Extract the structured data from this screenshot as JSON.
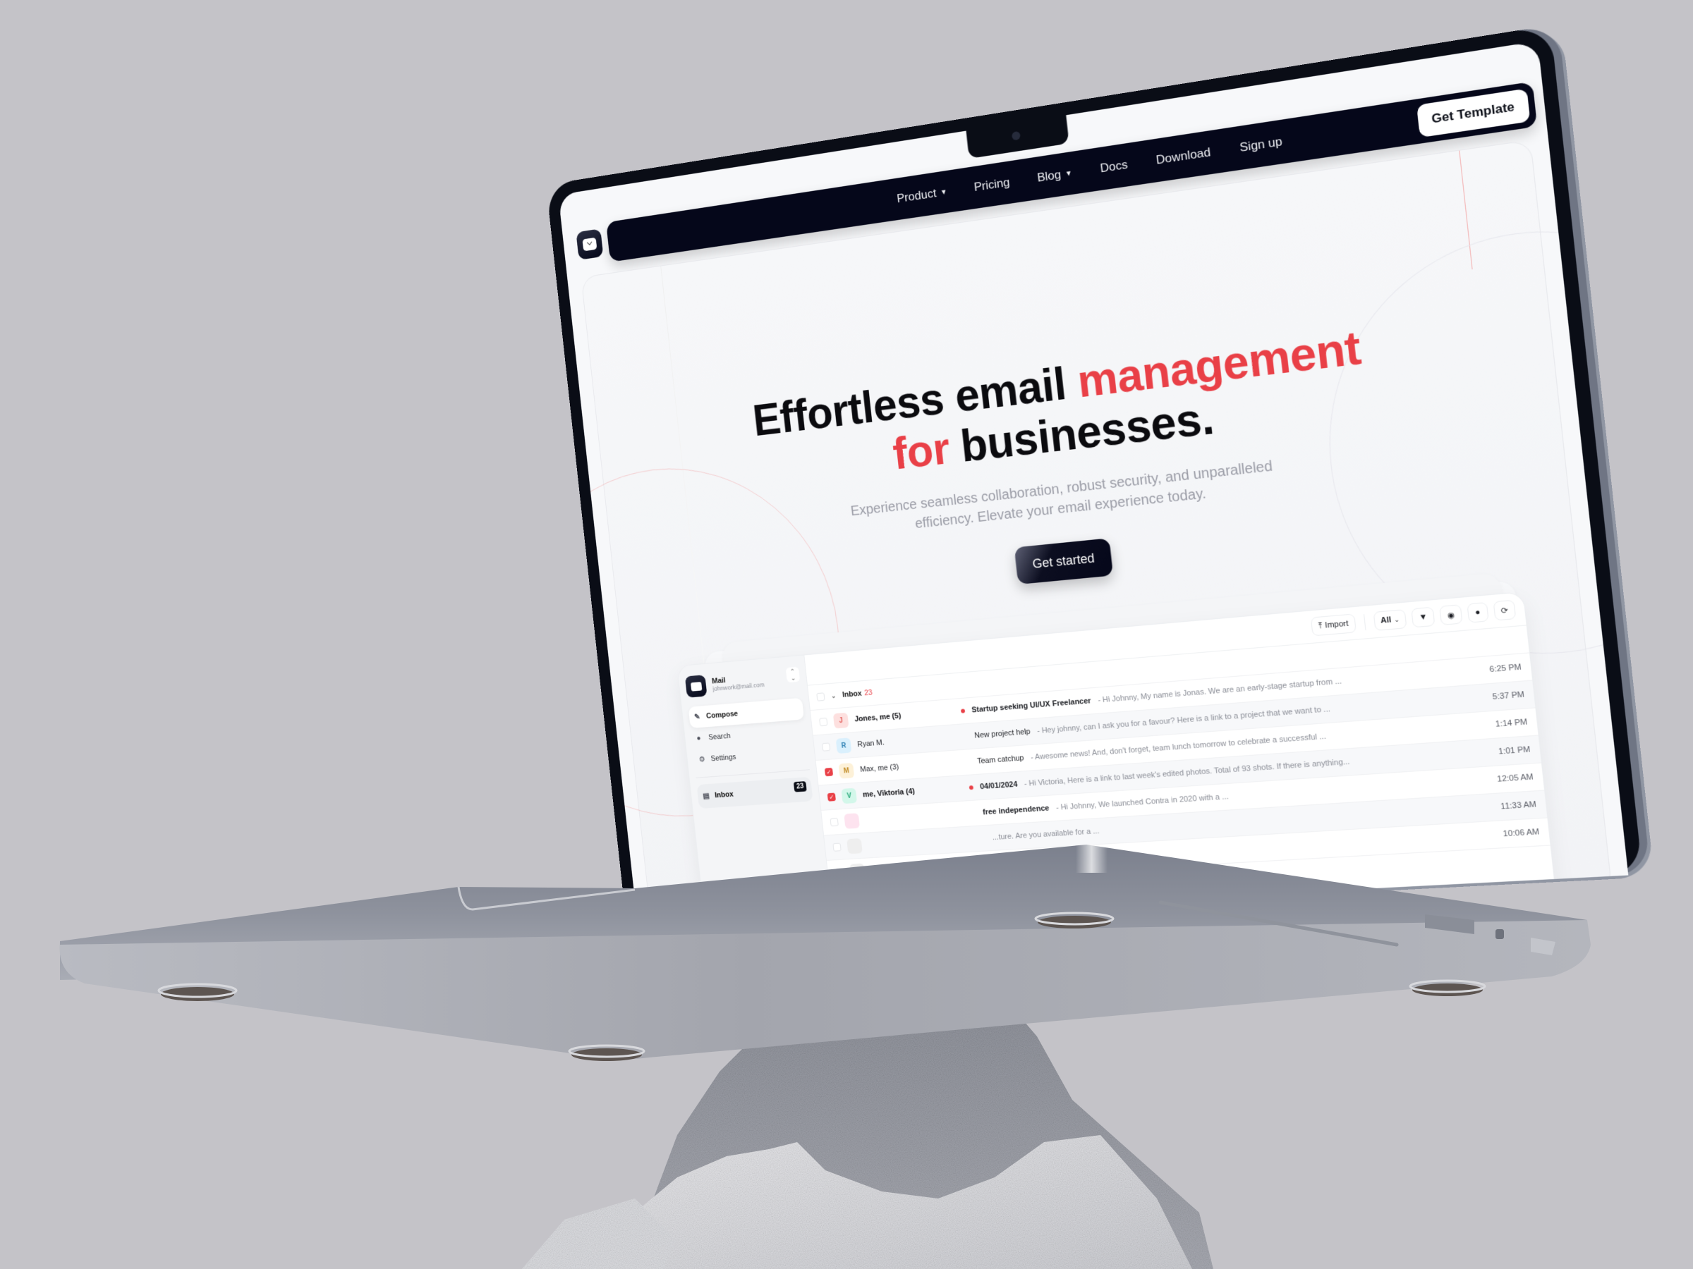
{
  "colors": {
    "background": "#c4c3c8",
    "accent": "#e94047",
    "nav_dark": "#05071a",
    "laptop_aluminum": "#9aa0ab"
  },
  "nav": {
    "logo_icon": "mail-envelope-icon",
    "links": [
      {
        "label": "Product",
        "has_dropdown": true
      },
      {
        "label": "Pricing",
        "has_dropdown": false
      },
      {
        "label": "Blog",
        "has_dropdown": true
      },
      {
        "label": "Docs",
        "has_dropdown": false
      },
      {
        "label": "Download",
        "has_dropdown": false
      },
      {
        "label": "Sign up",
        "has_dropdown": false
      }
    ],
    "cta_label": "Get Template"
  },
  "hero": {
    "title_part1": "Effortless email ",
    "title_accent1": "management",
    "title_accent2": "for",
    "title_part2": " businesses.",
    "subtitle_line1": "Experience seamless collaboration, robust security, and unparalleled",
    "subtitle_line2": "efficiency. Elevate your email experience today.",
    "cta_label": "Get started"
  },
  "mail_app": {
    "account": {
      "name": "Mail",
      "email": "johnwork@mail.com"
    },
    "sidebar": {
      "items": [
        {
          "label": "Compose",
          "icon": "pencil-icon",
          "active": true
        },
        {
          "label": "Search",
          "icon": "search-icon",
          "active": false
        },
        {
          "label": "Settings",
          "icon": "gear-icon",
          "active": false
        }
      ],
      "inbox": {
        "label": "Inbox",
        "count": "23",
        "icon": "inbox-icon"
      }
    },
    "toolbar": {
      "import_label": "Import",
      "filter_select": "All",
      "icons": [
        "filter-icon",
        "info-icon",
        "search-icon",
        "refresh-icon"
      ]
    },
    "list_header": {
      "label": "Inbox",
      "count": "23"
    },
    "emails": [
      {
        "initial": "J",
        "sender": "Jones, me (5)",
        "sender_bold": true,
        "unread_dot": true,
        "subject": "Startup seeking UI/UX Freelancer",
        "subject_bold": true,
        "preview": "- Hi Johnny, My name is Jonas. We are an early-stage startup from ...",
        "time": "6:25 PM",
        "checked": false,
        "avatar_bg": "#fde0df",
        "avatar_fg": "#e25b57"
      },
      {
        "initial": "R",
        "sender": "Ryan M.",
        "sender_bold": false,
        "unread_dot": false,
        "subject": "New project help",
        "subject_bold": false,
        "preview": "- Hey johnny, can I ask you for a favour? Here is a link to a project that we want to ...",
        "time": "5:37 PM",
        "checked": false,
        "avatar_bg": "#daf0fd",
        "avatar_fg": "#2b7fb3"
      },
      {
        "initial": "M",
        "sender": "Max, me (3)",
        "sender_bold": false,
        "unread_dot": false,
        "subject": "Team catchup",
        "subject_bold": false,
        "preview": "- Awesome news! And, don't forget, team lunch tomorrow to celebrate a successful ...",
        "time": "1:14 PM",
        "checked": true,
        "avatar_bg": "#fdf1d8",
        "avatar_fg": "#c08a22"
      },
      {
        "initial": "V",
        "sender": "me, Viktoria (4)",
        "sender_bold": true,
        "unread_dot": true,
        "subject": "04/01/2024",
        "subject_bold": true,
        "preview": "- Hi Victoria, Here is a link to last week's edited photos. Total of 93 shots. If there is anything...",
        "time": "1:01 PM",
        "checked": true,
        "avatar_bg": "#d3f7ea",
        "avatar_fg": "#23a777"
      },
      {
        "initial": "",
        "sender": "",
        "sender_bold": true,
        "unread_dot": false,
        "subject": "free independence",
        "subject_bold": true,
        "preview": "- Hi Johnny, We launched Contra in 2020 with a ...",
        "time": "12:05 AM",
        "checked": false,
        "avatar_bg": "#fde3ef",
        "avatar_fg": "#d14a86"
      },
      {
        "initial": "",
        "sender": "",
        "sender_bold": false,
        "unread_dot": false,
        "subject": "",
        "subject_bold": false,
        "preview": "...ture. Are you available for a ...",
        "time": "11:33 AM",
        "checked": false,
        "avatar_bg": "#eeeeee",
        "avatar_fg": "#777777"
      },
      {
        "initial": "",
        "sender": "",
        "sender_bold": false,
        "unread_dot": false,
        "subject": "",
        "subject_bold": false,
        "preview": "",
        "time": "10:06 AM",
        "checked": false,
        "avatar_bg": "#eeeeee",
        "avatar_fg": "#777777"
      }
    ]
  },
  "hardware": {
    "webcam_icon": "camera-icon",
    "ports": [
      "sd-card-slot",
      "hdmi-port",
      "magsafe-port"
    ]
  }
}
